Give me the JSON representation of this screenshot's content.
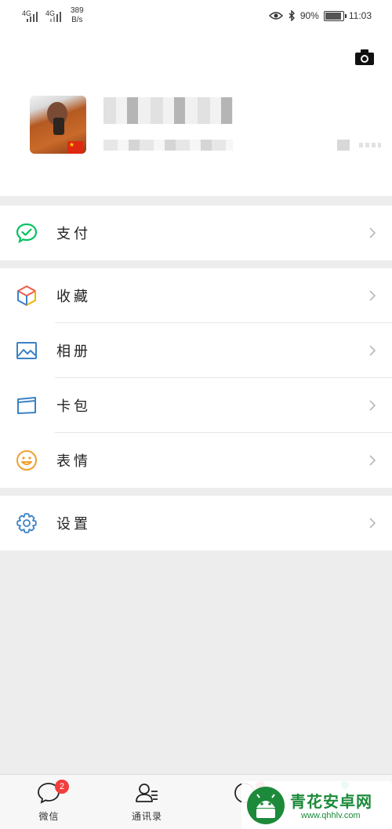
{
  "status_bar": {
    "signal1": "4G",
    "signal2": "4G",
    "net_speed_value": "389",
    "net_speed_unit": "B/s",
    "battery_pct": "90%",
    "battery_level": 0.9,
    "time": "11:03"
  },
  "profile": {
    "flag": "★"
  },
  "menu": {
    "pay": "支付",
    "favorites": "收藏",
    "album": "相册",
    "cards": "卡包",
    "stickers": "表情",
    "settings": "设置"
  },
  "nav": {
    "chats": "微信",
    "chats_badge": "2",
    "contacts": "通讯录"
  },
  "watermark": {
    "title": "青花安卓网",
    "url": "www.qhhlv.com"
  },
  "colors": {
    "wechat_green": "#07c160",
    "badge_red": "#f23c3c",
    "icon_blue": "#3b82c4",
    "smiley_orange": "#f0a030"
  }
}
